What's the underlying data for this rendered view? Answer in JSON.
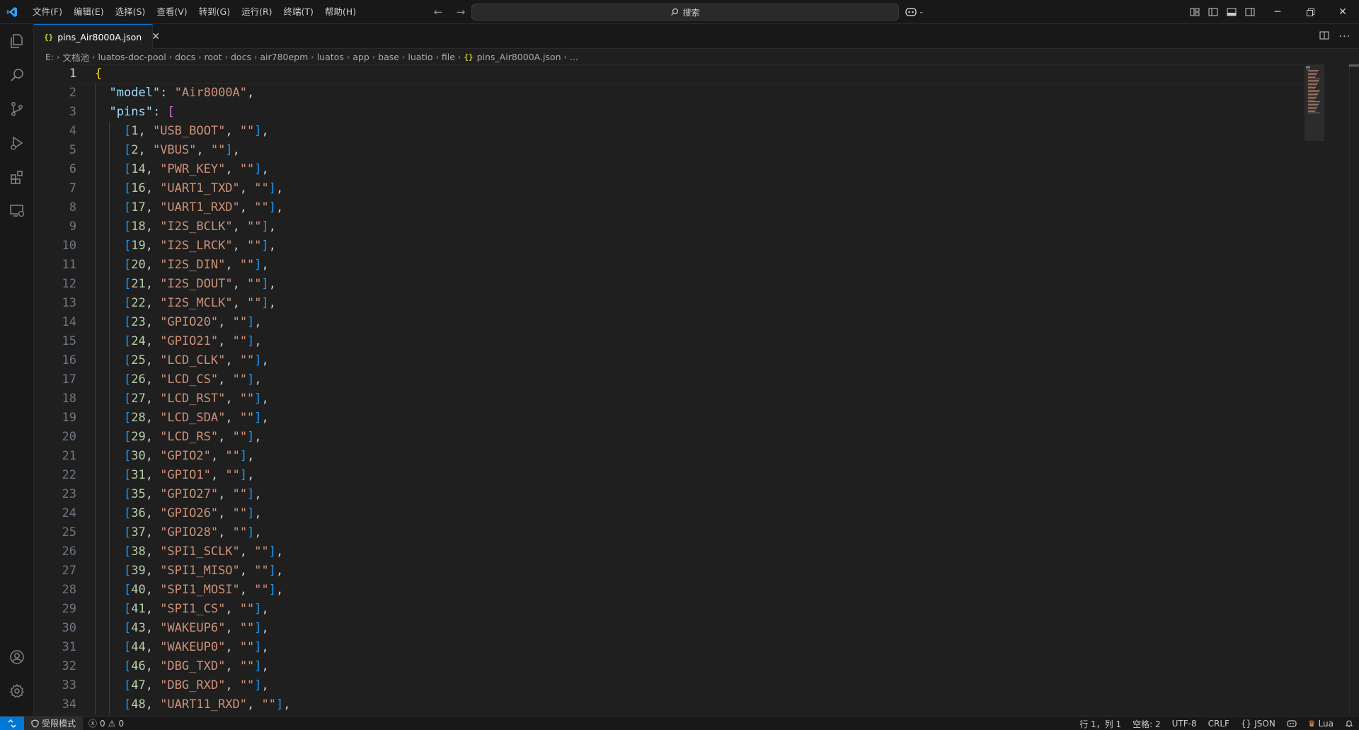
{
  "menu": [
    "文件(F)",
    "编辑(E)",
    "选择(S)",
    "查看(V)",
    "转到(G)",
    "运行(R)",
    "终端(T)",
    "帮助(H)"
  ],
  "search": {
    "label": "搜索"
  },
  "tab": {
    "filename": "pins_Air8000A.json",
    "icon": "{}"
  },
  "breadcrumb": [
    "E:",
    "文档池",
    "luatos-doc-pool",
    "docs",
    "root",
    "docs",
    "air780epm",
    "luatos",
    "app",
    "base",
    "luatio",
    "file",
    "pins_Air8000A.json",
    "..."
  ],
  "editor": {
    "model_key": "model",
    "model_value": "Air8000A",
    "pins_key": "pins",
    "pins": [
      [
        1,
        "USB_BOOT"
      ],
      [
        2,
        "VBUS"
      ],
      [
        14,
        "PWR_KEY"
      ],
      [
        16,
        "UART1_TXD"
      ],
      [
        17,
        "UART1_RXD"
      ],
      [
        18,
        "I2S_BCLK"
      ],
      [
        19,
        "I2S_LRCK"
      ],
      [
        20,
        "I2S_DIN"
      ],
      [
        21,
        "I2S_DOUT"
      ],
      [
        22,
        "I2S_MCLK"
      ],
      [
        23,
        "GPIO20"
      ],
      [
        24,
        "GPIO21"
      ],
      [
        25,
        "LCD_CLK"
      ],
      [
        26,
        "LCD_CS"
      ],
      [
        27,
        "LCD_RST"
      ],
      [
        28,
        "LCD_SDA"
      ],
      [
        29,
        "LCD_RS"
      ],
      [
        30,
        "GPIO2"
      ],
      [
        31,
        "GPIO1"
      ],
      [
        35,
        "GPIO27"
      ],
      [
        36,
        "GPIO26"
      ],
      [
        37,
        "GPIO28"
      ],
      [
        38,
        "SPI1_SCLK"
      ],
      [
        39,
        "SPI1_MISO"
      ],
      [
        40,
        "SPI1_MOSI"
      ],
      [
        41,
        "SPI1_CS"
      ],
      [
        43,
        "WAKEUP6"
      ],
      [
        44,
        "WAKEUP0"
      ],
      [
        46,
        "DBG_TXD"
      ],
      [
        47,
        "DBG_RXD"
      ],
      [
        48,
        "UART11_RXD"
      ]
    ],
    "line_numbers": [
      "1",
      "2",
      "3",
      "4",
      "5",
      "6",
      "7",
      "8",
      "9",
      "10",
      "11",
      "12",
      "13",
      "14",
      "15",
      "16",
      "17",
      "18",
      "19",
      "20",
      "21",
      "22",
      "23",
      "24",
      "25",
      "26",
      "27",
      "28",
      "29",
      "30",
      "31",
      "32",
      "33",
      "34"
    ]
  },
  "status": {
    "restricted_mode": "受限模式",
    "errors": "0",
    "warnings": "0",
    "position": "行 1，列 1",
    "spaces": "空格: 2",
    "encoding": "UTF-8",
    "eol": "CRLF",
    "language": "JSON",
    "lua": "Lua"
  },
  "colors": {
    "accent": "#0078d4",
    "key": "#9cdcfe",
    "string": "#ce9178",
    "number": "#b5cea8"
  }
}
